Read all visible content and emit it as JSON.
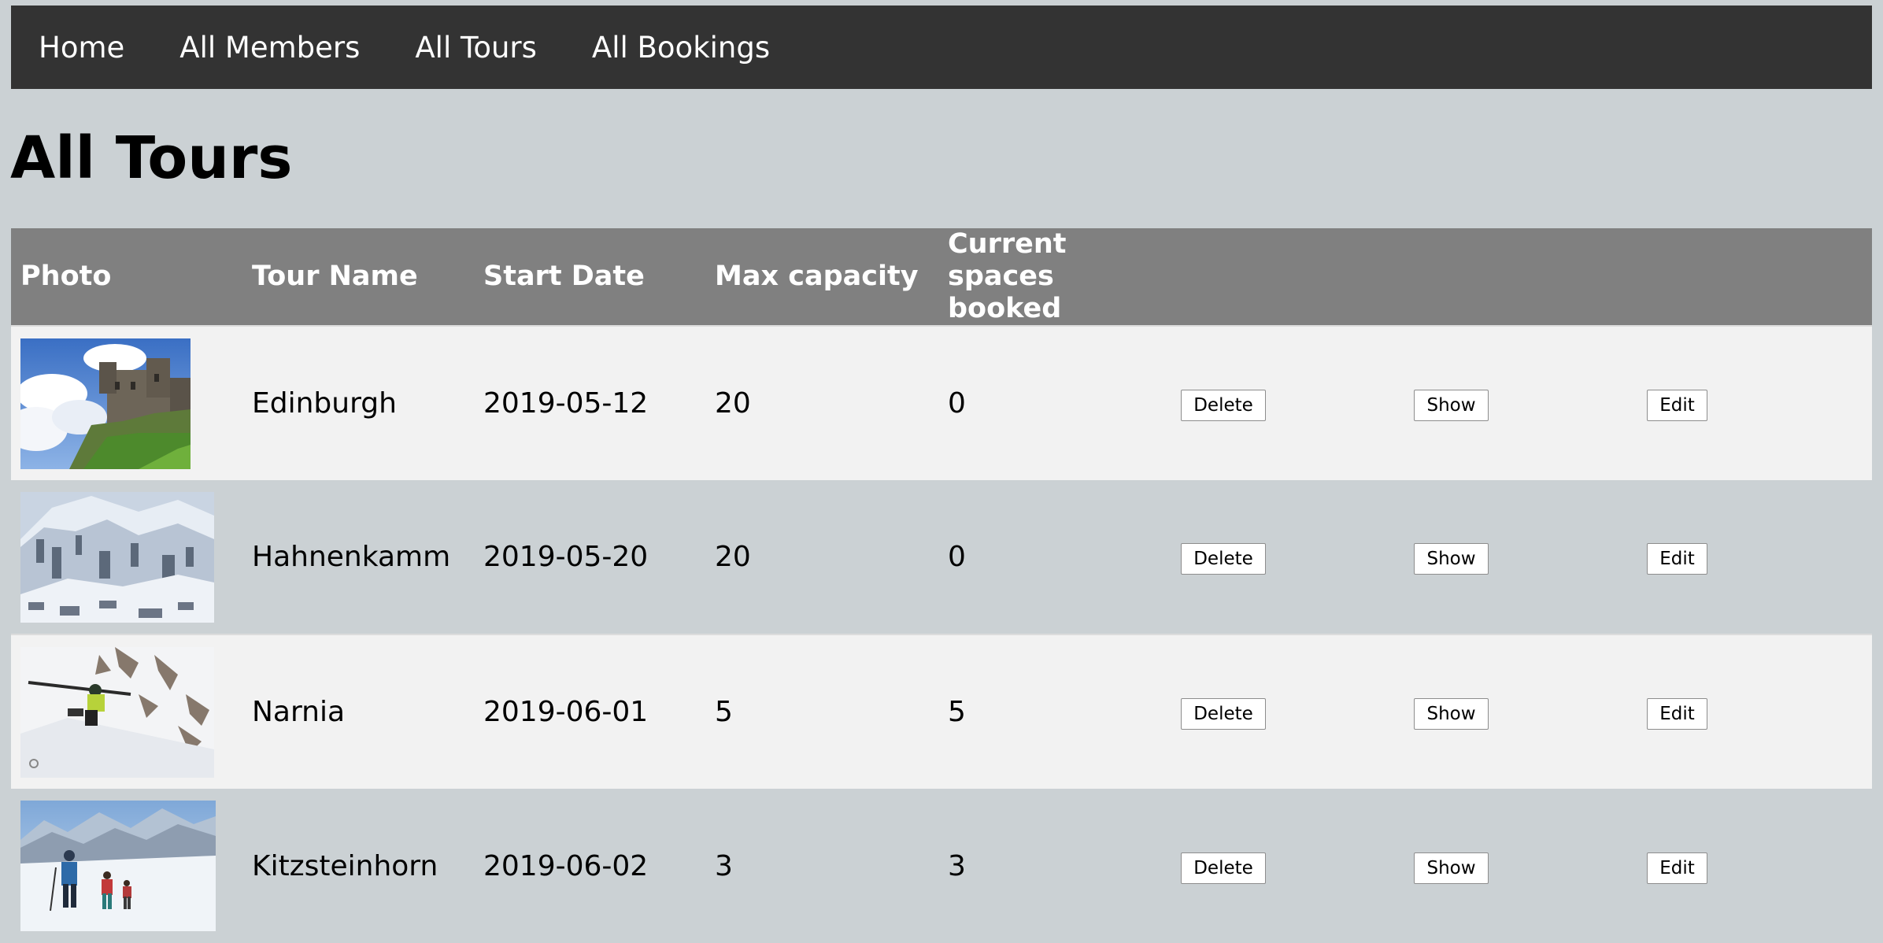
{
  "nav": {
    "items": [
      {
        "label": "Home"
      },
      {
        "label": "All Members"
      },
      {
        "label": "All Tours"
      },
      {
        "label": "All Bookings"
      }
    ]
  },
  "page": {
    "title": "All Tours"
  },
  "table": {
    "headers": {
      "photo": "Photo",
      "tour_name": "Tour Name",
      "start_date": "Start Date",
      "max_capacity": "Max capacity",
      "current_spaces_booked_line1": "Current spaces",
      "current_spaces_booked_line2": "booked"
    },
    "buttons": {
      "delete": "Delete",
      "show": "Show",
      "edit": "Edit"
    },
    "rows": [
      {
        "photo_icon": "castle-photo",
        "tour_name": "Edinburgh",
        "start_date": "2019-05-12",
        "max_capacity": "20",
        "current_spaces_booked": "0"
      },
      {
        "photo_icon": "snowy-valley-photo",
        "tour_name": "Hahnenkamm",
        "start_date": "2019-05-20",
        "max_capacity": "20",
        "current_spaces_booked": "0"
      },
      {
        "photo_icon": "skier-slope-photo",
        "tour_name": "Narnia",
        "start_date": "2019-06-01",
        "max_capacity": "5",
        "current_spaces_booked": "5"
      },
      {
        "photo_icon": "ski-tourers-photo",
        "tour_name": "Kitzsteinhorn",
        "start_date": "2019-06-02",
        "max_capacity": "3",
        "current_spaces_booked": "3"
      }
    ]
  },
  "colors": {
    "background": "#cbd1d4",
    "navbar": "#333333",
    "table_header": "#808080",
    "row_light": "#f2f2f2"
  }
}
